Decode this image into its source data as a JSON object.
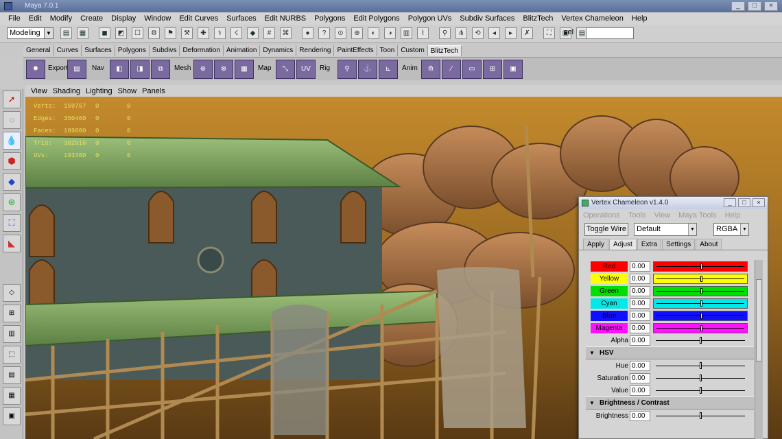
{
  "window": {
    "title": "Maya 7.0.1"
  },
  "menu": [
    "File",
    "Edit",
    "Modify",
    "Create",
    "Display",
    "Window",
    "Edit Curves",
    "Surfaces",
    "Edit NURBS",
    "Polygons",
    "Edit Polygons",
    "Polygon UVs",
    "Subdiv Surfaces",
    "BlitzTech",
    "Vertex Chameleon",
    "Help"
  ],
  "statusline": {
    "mode": "Modeling",
    "sel_label": "sel",
    "sel_value": ""
  },
  "shelf_tabs": [
    "General",
    "Curves",
    "Surfaces",
    "Polygons",
    "Subdivs",
    "Deformation",
    "Animation",
    "Dynamics",
    "Rendering",
    "PaintEffects",
    "Toon",
    "Custom",
    "BlitzTech"
  ],
  "shelf_active_tab": "BlitzTech",
  "shelf_labels": {
    "export": "Export",
    "nav": "Nav",
    "mesh": "Mesh",
    "map": "Map",
    "rig": "Rig",
    "anim": "Anim"
  },
  "viewport": {
    "menu": [
      "View",
      "Shading",
      "Lighting",
      "Show",
      "Panels"
    ],
    "hud": [
      {
        "label": "Verts:",
        "v1": "159757",
        "v2": "0",
        "v3": "0"
      },
      {
        "label": "Edges:",
        "v1": "350460",
        "v2": "0",
        "v3": "0"
      },
      {
        "label": "Faces:",
        "v1": "189000",
        "v2": "0",
        "v3": "0"
      },
      {
        "label": "Tris:",
        "v1": "302916",
        "v2": "0",
        "v3": "0"
      },
      {
        "label": "UVs:",
        "v1": "193380",
        "v2": "0",
        "v3": "0"
      }
    ]
  },
  "vc": {
    "title": "Vertex Chameleon v1.4.0",
    "menu": [
      "Operations",
      "Tools",
      "View",
      "Maya Tools",
      "Help"
    ],
    "toggle_wire": "Toggle Wire",
    "preset": "Default",
    "mode": "RGBA",
    "tabs": [
      "Apply",
      "Adjust",
      "Extra",
      "Settings",
      "About"
    ],
    "active_tab": "Adjust",
    "channels": [
      {
        "name": "Red",
        "value": "0.00",
        "color": "#ff0000",
        "pos": 0.5
      },
      {
        "name": "Yellow",
        "value": "0.00",
        "color": "#ffff00",
        "pos": 0.5
      },
      {
        "name": "Green",
        "value": "0.00",
        "color": "#00e000",
        "pos": 0.5
      },
      {
        "name": "Cyan",
        "value": "0.00",
        "color": "#00e8e8",
        "pos": 0.5
      },
      {
        "name": "Blue",
        "value": "0.00",
        "color": "#1010ff",
        "pos": 0.5
      },
      {
        "name": "Magenta",
        "value": "0.00",
        "color": "#ff10ff",
        "pos": 0.5
      }
    ],
    "alpha": {
      "name": "Alpha",
      "value": "0.00",
      "pos": 0.5
    },
    "hsv_title": "HSV",
    "hsv": [
      {
        "name": "Hue",
        "value": "0.00",
        "pos": 0.5
      },
      {
        "name": "Saturation",
        "value": "0.00",
        "pos": 0.5
      },
      {
        "name": "Value",
        "value": "0.00",
        "pos": 0.5
      }
    ],
    "bc_title": "Brightness / Contrast",
    "bc": [
      {
        "name": "Brightness",
        "value": "0.00",
        "pos": 0.5
      }
    ]
  }
}
